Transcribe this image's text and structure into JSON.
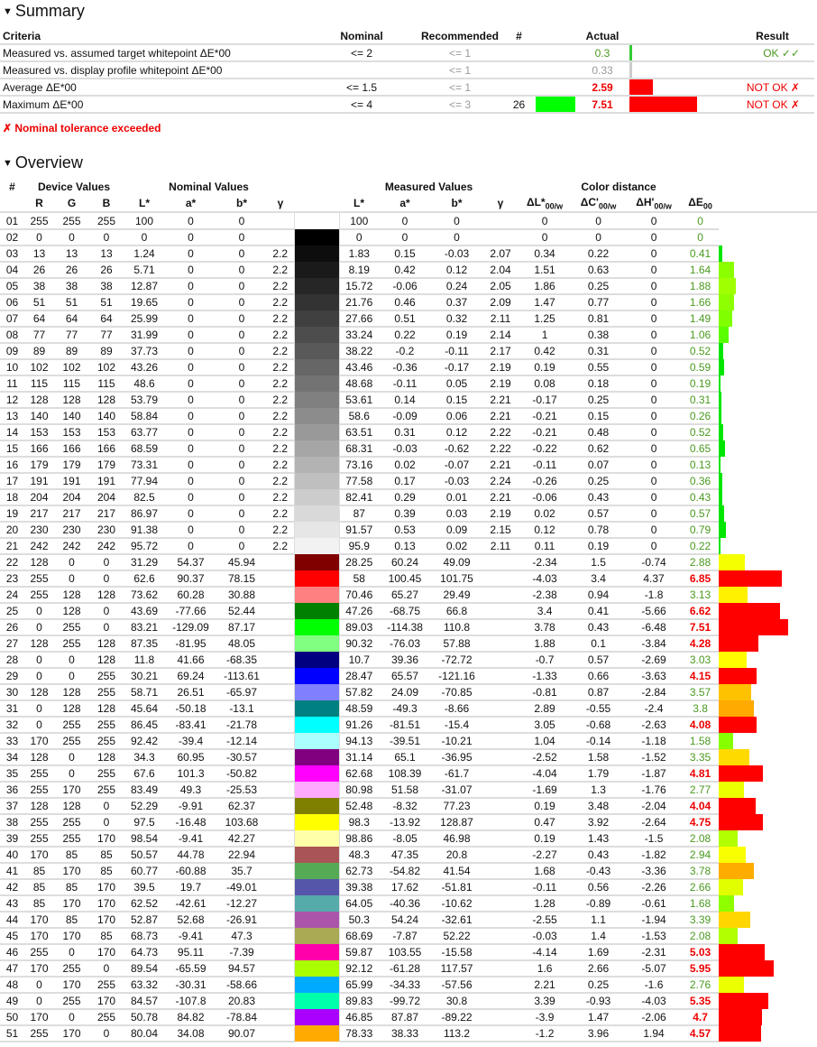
{
  "summary": {
    "heading": "Summary",
    "headers": {
      "criteria": "Criteria",
      "nominal": "Nominal",
      "recommended": "Recommended",
      "count": "#",
      "actual": "Actual",
      "result": "Result"
    },
    "rows": [
      {
        "criteria": "Measured vs. assumed target whitepoint ΔE*00",
        "nominal": "<= 2",
        "recommended": "<= 1",
        "count": "",
        "swatch": "",
        "actual": "0.3",
        "actual_status": "ok",
        "bar_value": 0.3,
        "bar_color": "#33cc33",
        "result": "OK ✓✓",
        "result_status": "ok"
      },
      {
        "criteria": "Measured vs. display profile whitepoint ΔE*00",
        "nominal": "",
        "recommended": "<= 1",
        "count": "",
        "swatch": "",
        "actual": "0.33",
        "actual_status": "neutral",
        "bar_value": 0.33,
        "bar_color": "#cccccc",
        "result": "",
        "result_status": ""
      },
      {
        "criteria": "Average ΔE*00",
        "nominal": "<= 1.5",
        "recommended": "<= 1",
        "count": "",
        "swatch": "",
        "actual": "2.59",
        "actual_status": "bad",
        "bar_value": 2.59,
        "bar_color": "#ff0000",
        "result": "NOT OK ✗",
        "result_status": "bad"
      },
      {
        "criteria": "Maximum ΔE*00",
        "nominal": "<= 4",
        "recommended": "<= 3",
        "count": "26",
        "swatch": "#00ff00",
        "actual": "7.51",
        "actual_status": "bad",
        "bar_value": 7.51,
        "bar_color": "#ff0000",
        "result": "NOT OK ✗",
        "result_status": "bad"
      }
    ],
    "note": "✗ Nominal tolerance exceeded"
  },
  "overview": {
    "heading": "Overview",
    "groups": {
      "num": "#",
      "device": "Device Values",
      "nominal": "Nominal Values",
      "measured": "Measured Values",
      "distance": "Color distance"
    },
    "columns": {
      "r": "R",
      "g": "G",
      "b": "B",
      "L": "L*",
      "a": "a*",
      "bb": "b*",
      "gamma": "γ",
      "mL": "L*",
      "ma": "a*",
      "mb": "b*",
      "mgamma": "γ",
      "dL": "ΔL*",
      "dL_sub": "00/w",
      "dC": "ΔC'",
      "dC_sub": "00/w",
      "dH": "ΔH'",
      "dH_sub": "00/w",
      "dE": "ΔE",
      "dE_sub": "00"
    },
    "rows": [
      [
        "01",
        "255",
        "255",
        "255",
        "100",
        "0",
        "0",
        "",
        "100",
        "0",
        "0",
        "",
        "0",
        "0",
        "0",
        "0"
      ],
      [
        "02",
        "0",
        "0",
        "0",
        "0",
        "0",
        "0",
        "",
        "0",
        "0",
        "0",
        "",
        "0",
        "0",
        "0",
        "0"
      ],
      [
        "03",
        "13",
        "13",
        "13",
        "1.24",
        "0",
        "0",
        "2.2",
        "1.83",
        "0.15",
        "-0.03",
        "2.07",
        "0.34",
        "0.22",
        "0",
        "0.41"
      ],
      [
        "04",
        "26",
        "26",
        "26",
        "5.71",
        "0",
        "0",
        "2.2",
        "8.19",
        "0.42",
        "0.12",
        "2.04",
        "1.51",
        "0.63",
        "0",
        "1.64"
      ],
      [
        "05",
        "38",
        "38",
        "38",
        "12.87",
        "0",
        "0",
        "2.2",
        "15.72",
        "-0.06",
        "0.24",
        "2.05",
        "1.86",
        "0.25",
        "0",
        "1.88"
      ],
      [
        "06",
        "51",
        "51",
        "51",
        "19.65",
        "0",
        "0",
        "2.2",
        "21.76",
        "0.46",
        "0.37",
        "2.09",
        "1.47",
        "0.77",
        "0",
        "1.66"
      ],
      [
        "07",
        "64",
        "64",
        "64",
        "25.99",
        "0",
        "0",
        "2.2",
        "27.66",
        "0.51",
        "0.32",
        "2.11",
        "1.25",
        "0.81",
        "0",
        "1.49"
      ],
      [
        "08",
        "77",
        "77",
        "77",
        "31.99",
        "0",
        "0",
        "2.2",
        "33.24",
        "0.22",
        "0.19",
        "2.14",
        "1",
        "0.38",
        "0",
        "1.06"
      ],
      [
        "09",
        "89",
        "89",
        "89",
        "37.73",
        "0",
        "0",
        "2.2",
        "38.22",
        "-0.2",
        "-0.11",
        "2.17",
        "0.42",
        "0.31",
        "0",
        "0.52"
      ],
      [
        "10",
        "102",
        "102",
        "102",
        "43.26",
        "0",
        "0",
        "2.2",
        "43.46",
        "-0.36",
        "-0.17",
        "2.19",
        "0.19",
        "0.55",
        "0",
        "0.59"
      ],
      [
        "11",
        "115",
        "115",
        "115",
        "48.6",
        "0",
        "0",
        "2.2",
        "48.68",
        "-0.11",
        "0.05",
        "2.19",
        "0.08",
        "0.18",
        "0",
        "0.19"
      ],
      [
        "12",
        "128",
        "128",
        "128",
        "53.79",
        "0",
        "0",
        "2.2",
        "53.61",
        "0.14",
        "0.15",
        "2.21",
        "-0.17",
        "0.25",
        "0",
        "0.31"
      ],
      [
        "13",
        "140",
        "140",
        "140",
        "58.84",
        "0",
        "0",
        "2.2",
        "58.6",
        "-0.09",
        "0.06",
        "2.21",
        "-0.21",
        "0.15",
        "0",
        "0.26"
      ],
      [
        "14",
        "153",
        "153",
        "153",
        "63.77",
        "0",
        "0",
        "2.2",
        "63.51",
        "0.31",
        "0.12",
        "2.22",
        "-0.21",
        "0.48",
        "0",
        "0.52"
      ],
      [
        "15",
        "166",
        "166",
        "166",
        "68.59",
        "0",
        "0",
        "2.2",
        "68.31",
        "-0.03",
        "-0.62",
        "2.22",
        "-0.22",
        "0.62",
        "0",
        "0.65"
      ],
      [
        "16",
        "179",
        "179",
        "179",
        "73.31",
        "0",
        "0",
        "2.2",
        "73.16",
        "0.02",
        "-0.07",
        "2.21",
        "-0.11",
        "0.07",
        "0",
        "0.13"
      ],
      [
        "17",
        "191",
        "191",
        "191",
        "77.94",
        "0",
        "0",
        "2.2",
        "77.58",
        "0.17",
        "-0.03",
        "2.24",
        "-0.26",
        "0.25",
        "0",
        "0.36"
      ],
      [
        "18",
        "204",
        "204",
        "204",
        "82.5",
        "0",
        "0",
        "2.2",
        "82.41",
        "0.29",
        "0.01",
        "2.21",
        "-0.06",
        "0.43",
        "0",
        "0.43"
      ],
      [
        "19",
        "217",
        "217",
        "217",
        "86.97",
        "0",
        "0",
        "2.2",
        "87",
        "0.39",
        "0.03",
        "2.19",
        "0.02",
        "0.57",
        "0",
        "0.57"
      ],
      [
        "20",
        "230",
        "230",
        "230",
        "91.38",
        "0",
        "0",
        "2.2",
        "91.57",
        "0.53",
        "0.09",
        "2.15",
        "0.12",
        "0.78",
        "0",
        "0.79"
      ],
      [
        "21",
        "242",
        "242",
        "242",
        "95.72",
        "0",
        "0",
        "2.2",
        "95.9",
        "0.13",
        "0.02",
        "2.11",
        "0.11",
        "0.19",
        "0",
        "0.22"
      ],
      [
        "22",
        "128",
        "0",
        "0",
        "31.29",
        "54.37",
        "45.94",
        "",
        "28.25",
        "60.24",
        "49.09",
        "",
        "-2.34",
        "1.5",
        "-0.74",
        "2.88"
      ],
      [
        "23",
        "255",
        "0",
        "0",
        "62.6",
        "90.37",
        "78.15",
        "",
        "58",
        "100.45",
        "101.75",
        "",
        "-4.03",
        "3.4",
        "4.37",
        "6.85"
      ],
      [
        "24",
        "255",
        "128",
        "128",
        "73.62",
        "60.28",
        "30.88",
        "",
        "70.46",
        "65.27",
        "29.49",
        "",
        "-2.38",
        "0.94",
        "-1.8",
        "3.13"
      ],
      [
        "25",
        "0",
        "128",
        "0",
        "43.69",
        "-77.66",
        "52.44",
        "",
        "47.26",
        "-68.75",
        "66.8",
        "",
        "3.4",
        "0.41",
        "-5.66",
        "6.62"
      ],
      [
        "26",
        "0",
        "255",
        "0",
        "83.21",
        "-129.09",
        "87.17",
        "",
        "89.03",
        "-114.38",
        "110.8",
        "",
        "3.78",
        "0.43",
        "-6.48",
        "7.51"
      ],
      [
        "27",
        "128",
        "255",
        "128",
        "87.35",
        "-81.95",
        "48.05",
        "",
        "90.32",
        "-76.03",
        "57.88",
        "",
        "1.88",
        "0.1",
        "-3.84",
        "4.28"
      ],
      [
        "28",
        "0",
        "0",
        "128",
        "11.8",
        "41.66",
        "-68.35",
        "",
        "10.7",
        "39.36",
        "-72.72",
        "",
        "-0.7",
        "0.57",
        "-2.69",
        "3.03"
      ],
      [
        "29",
        "0",
        "0",
        "255",
        "30.21",
        "69.24",
        "-113.61",
        "",
        "28.47",
        "65.57",
        "-121.16",
        "",
        "-1.33",
        "0.66",
        "-3.63",
        "4.15"
      ],
      [
        "30",
        "128",
        "128",
        "255",
        "58.71",
        "26.51",
        "-65.97",
        "",
        "57.82",
        "24.09",
        "-70.85",
        "",
        "-0.81",
        "0.87",
        "-2.84",
        "3.57"
      ],
      [
        "31",
        "0",
        "128",
        "128",
        "45.64",
        "-50.18",
        "-13.1",
        "",
        "48.59",
        "-49.3",
        "-8.66",
        "",
        "2.89",
        "-0.55",
        "-2.4",
        "3.8"
      ],
      [
        "32",
        "0",
        "255",
        "255",
        "86.45",
        "-83.41",
        "-21.78",
        "",
        "91.26",
        "-81.51",
        "-15.4",
        "",
        "3.05",
        "-0.68",
        "-2.63",
        "4.08"
      ],
      [
        "33",
        "170",
        "255",
        "255",
        "92.42",
        "-39.4",
        "-12.14",
        "",
        "94.13",
        "-39.51",
        "-10.21",
        "",
        "1.04",
        "-0.14",
        "-1.18",
        "1.58"
      ],
      [
        "34",
        "128",
        "0",
        "128",
        "34.3",
        "60.95",
        "-30.57",
        "",
        "31.14",
        "65.1",
        "-36.95",
        "",
        "-2.52",
        "1.58",
        "-1.52",
        "3.35"
      ],
      [
        "35",
        "255",
        "0",
        "255",
        "67.6",
        "101.3",
        "-50.82",
        "",
        "62.68",
        "108.39",
        "-61.7",
        "",
        "-4.04",
        "1.79",
        "-1.87",
        "4.81"
      ],
      [
        "36",
        "255",
        "170",
        "255",
        "83.49",
        "49.3",
        "-25.53",
        "",
        "80.98",
        "51.58",
        "-31.07",
        "",
        "-1.69",
        "1.3",
        "-1.76",
        "2.77"
      ],
      [
        "37",
        "128",
        "128",
        "0",
        "52.29",
        "-9.91",
        "62.37",
        "",
        "52.48",
        "-8.32",
        "77.23",
        "",
        "0.19",
        "3.48",
        "-2.04",
        "4.04"
      ],
      [
        "38",
        "255",
        "255",
        "0",
        "97.5",
        "-16.48",
        "103.68",
        "",
        "98.3",
        "-13.92",
        "128.87",
        "",
        "0.47",
        "3.92",
        "-2.64",
        "4.75"
      ],
      [
        "39",
        "255",
        "255",
        "170",
        "98.54",
        "-9.41",
        "42.27",
        "",
        "98.86",
        "-8.05",
        "46.98",
        "",
        "0.19",
        "1.43",
        "-1.5",
        "2.08"
      ],
      [
        "40",
        "170",
        "85",
        "85",
        "50.57",
        "44.78",
        "22.94",
        "",
        "48.3",
        "47.35",
        "20.8",
        "",
        "-2.27",
        "0.43",
        "-1.82",
        "2.94"
      ],
      [
        "41",
        "85",
        "170",
        "85",
        "60.77",
        "-60.88",
        "35.7",
        "",
        "62.73",
        "-54.82",
        "41.54",
        "",
        "1.68",
        "-0.43",
        "-3.36",
        "3.78"
      ],
      [
        "42",
        "85",
        "85",
        "170",
        "39.5",
        "19.7",
        "-49.01",
        "",
        "39.38",
        "17.62",
        "-51.81",
        "",
        "-0.11",
        "0.56",
        "-2.26",
        "2.66"
      ],
      [
        "43",
        "85",
        "170",
        "170",
        "62.52",
        "-42.61",
        "-12.27",
        "",
        "64.05",
        "-40.36",
        "-10.62",
        "",
        "1.28",
        "-0.89",
        "-0.61",
        "1.68"
      ],
      [
        "44",
        "170",
        "85",
        "170",
        "52.87",
        "52.68",
        "-26.91",
        "",
        "50.3",
        "54.24",
        "-32.61",
        "",
        "-2.55",
        "1.1",
        "-1.94",
        "3.39"
      ],
      [
        "45",
        "170",
        "170",
        "85",
        "68.73",
        "-9.41",
        "47.3",
        "",
        "68.69",
        "-7.87",
        "52.22",
        "",
        "-0.03",
        "1.4",
        "-1.53",
        "2.08"
      ],
      [
        "46",
        "255",
        "0",
        "170",
        "64.73",
        "95.11",
        "-7.39",
        "",
        "59.87",
        "103.55",
        "-15.58",
        "",
        "-4.14",
        "1.69",
        "-2.31",
        "5.03"
      ],
      [
        "47",
        "170",
        "255",
        "0",
        "89.54",
        "-65.59",
        "94.57",
        "",
        "92.12",
        "-61.28",
        "117.57",
        "",
        "1.6",
        "2.66",
        "-5.07",
        "5.95"
      ],
      [
        "48",
        "0",
        "170",
        "255",
        "63.32",
        "-30.31",
        "-58.66",
        "",
        "65.99",
        "-34.33",
        "-57.56",
        "",
        "2.21",
        "0.25",
        "-1.6",
        "2.76"
      ],
      [
        "49",
        "0",
        "255",
        "170",
        "84.57",
        "-107.8",
        "20.83",
        "",
        "89.83",
        "-99.72",
        "30.8",
        "",
        "3.39",
        "-0.93",
        "-4.03",
        "5.35"
      ],
      [
        "50",
        "170",
        "0",
        "255",
        "50.78",
        "84.82",
        "-78.84",
        "",
        "46.85",
        "87.87",
        "-89.22",
        "",
        "-3.9",
        "1.47",
        "-2.06",
        "4.7"
      ],
      [
        "51",
        "255",
        "170",
        "0",
        "80.04",
        "34.08",
        "90.07",
        "",
        "78.33",
        "38.33",
        "113.2",
        "",
        "-1.2",
        "3.96",
        "1.94",
        "4.57"
      ]
    ]
  }
}
